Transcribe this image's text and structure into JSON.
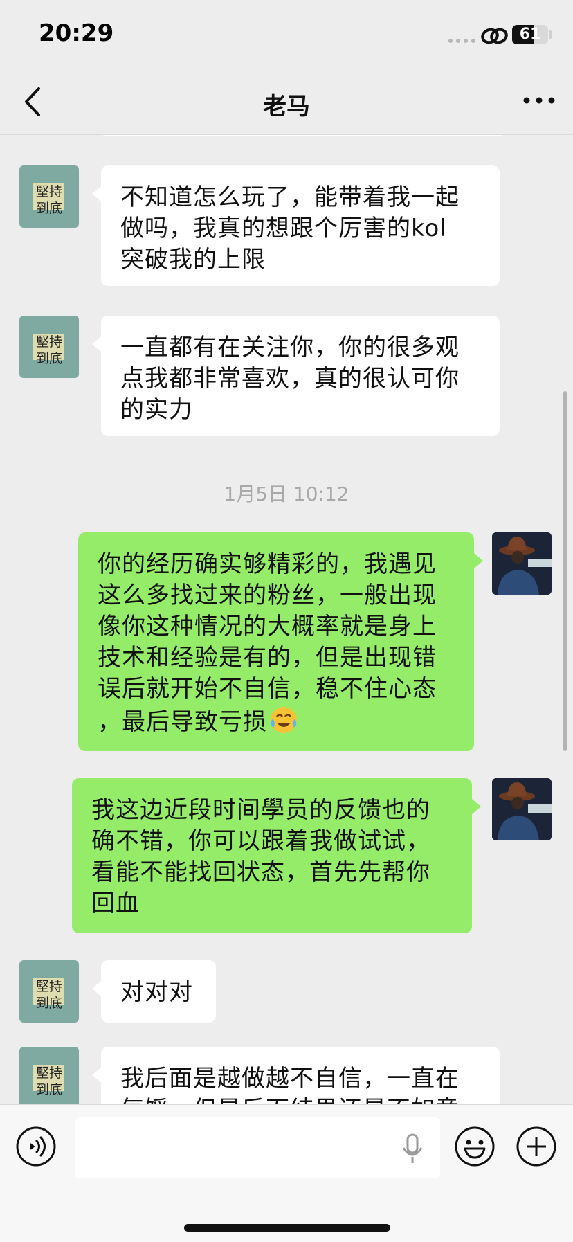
{
  "status_bar": {
    "time": "20:29",
    "battery": "61",
    "battery_level": 0.61
  },
  "nav": {
    "title": "老马"
  },
  "messages": [
    {
      "side": "in",
      "lines": [
        "不知道怎么玩了，能带着我一起",
        "做吗，我真的想跟个厉害的kol",
        "突破我的上限"
      ]
    },
    {
      "side": "in",
      "lines": [
        "一直都有在关注你，你的很多观",
        "点我都非常喜欢，真的很认可你",
        "的实力"
      ]
    },
    {
      "side": "out",
      "lines": [
        "你的经历确实够精彩的，我遇见",
        "这么多找过来的粉丝，一般出现",
        "像你这种情况的大概率就是身上",
        "技术和经验是有的，但是出现错",
        "误后就开始不自信，稳不住心态",
        "，最后导致亏损"
      ]
    },
    {
      "side": "out",
      "lines": [
        "我这边近段时间學员的反馈也的",
        "确不错，你可以跟着我做试试，",
        "看能不能找回状态，首先先帮你",
        "回血"
      ]
    },
    {
      "side": "in",
      "lines": [
        "对对对"
      ]
    },
    {
      "side": "in",
      "lines": [
        "我后面是越做越不自信，一直在",
        "气馁，但是后面结果还是不如意"
      ]
    }
  ],
  "timestamp": "1月5日 10:12",
  "friend_avatar_text": [
    "堅持",
    "到底"
  ],
  "emoji": "crying-laughing-emoji",
  "input": {
    "placeholder": ""
  },
  "icons": [
    "back-chevron-icon",
    "more-dots-icon",
    "voice-icon",
    "mic-icon",
    "emoji-icon",
    "plus-icon"
  ],
  "colors": {
    "bubble_out": "#95ec69",
    "bubble_in": "#ffffff",
    "background": "#ededed"
  }
}
